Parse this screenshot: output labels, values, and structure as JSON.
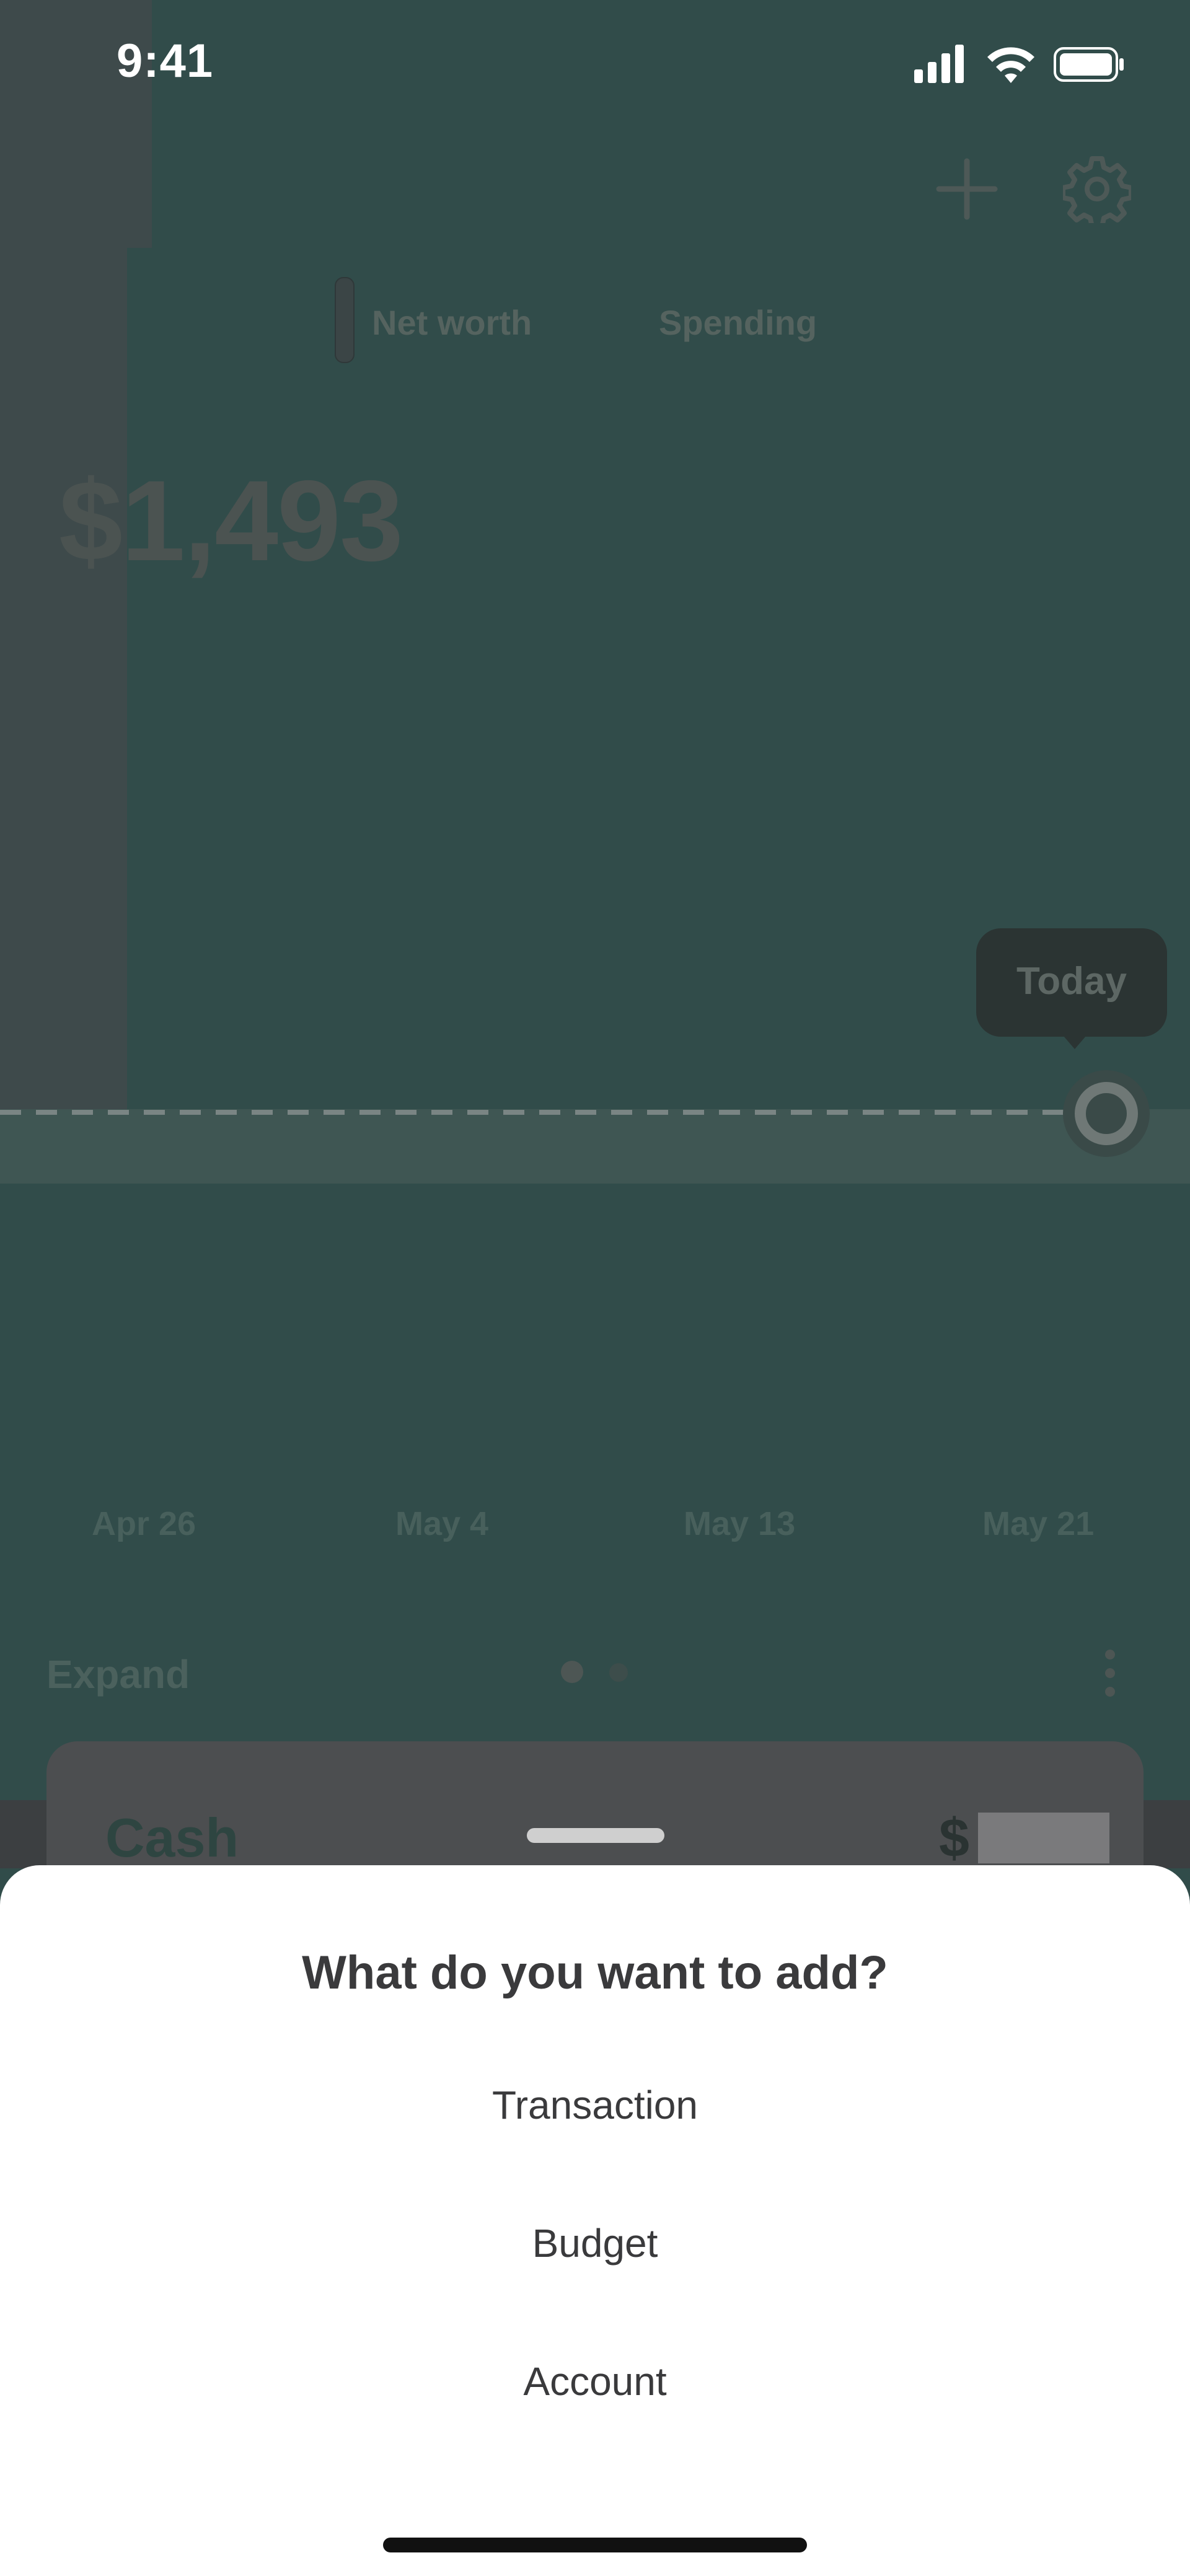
{
  "status_bar": {
    "time": "9:41",
    "icons": [
      "cellular-signal-icon",
      "wifi-icon",
      "battery-icon"
    ]
  },
  "header": {
    "icons": [
      "plus-icon",
      "gear-icon"
    ]
  },
  "tabs": [
    {
      "label": "Net worth",
      "selected": true
    },
    {
      "label": "Spending",
      "selected": false
    }
  ],
  "summary": {
    "net_worth_value": "$1,493"
  },
  "chart": {
    "today_label": "Today",
    "x_ticks": [
      "Apr 26",
      "May 4",
      "May 13",
      "May 21"
    ]
  },
  "accounts_section": {
    "expand_label": "Expand",
    "page_count": 2,
    "current_page": 1
  },
  "cash_card": {
    "label": "Cash",
    "amount_prefix": "$"
  },
  "sheet": {
    "title": "What do you want to add?",
    "options": [
      "Transaction",
      "Budget",
      "Account"
    ]
  },
  "colors": {
    "background_dimmed": "#314c4a",
    "sheet_background": "#ffffff",
    "text_primary": "#3a3a3c"
  }
}
